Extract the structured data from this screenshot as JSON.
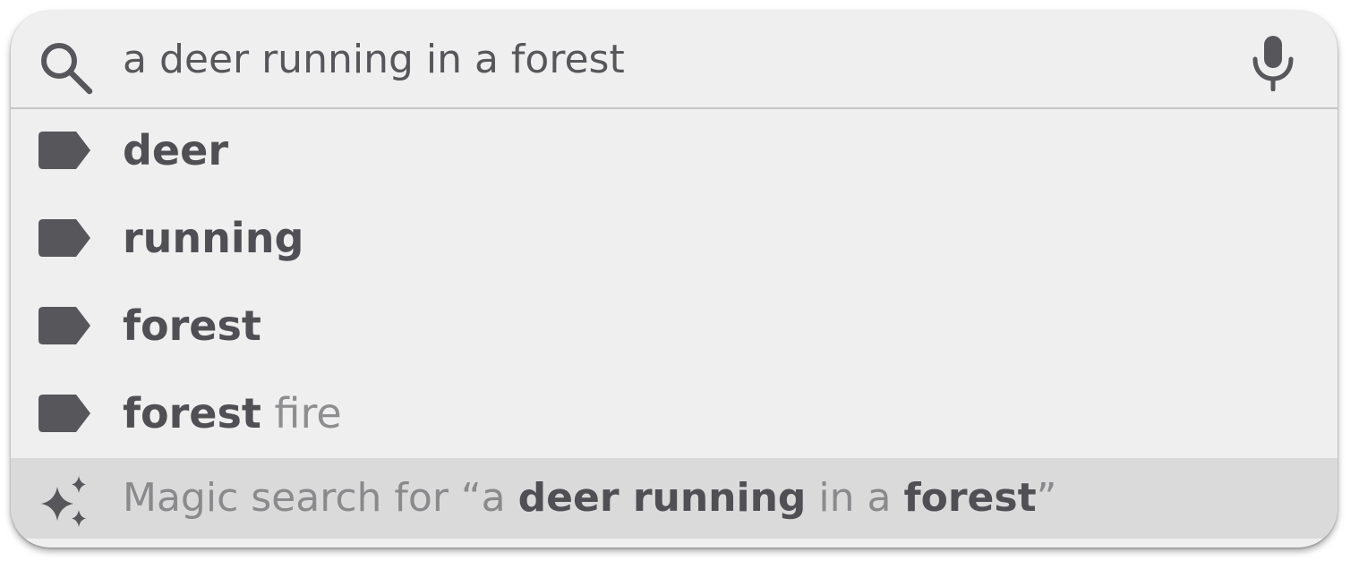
{
  "search": {
    "query": "a deer running in a forest",
    "search_icon": "search-icon",
    "mic_icon": "microphone-icon"
  },
  "suggestions": [
    {
      "icon": "label-icon",
      "bold": "deer",
      "rest": ""
    },
    {
      "icon": "label-icon",
      "bold": "running",
      "rest": ""
    },
    {
      "icon": "label-icon",
      "bold": "forest",
      "rest": ""
    },
    {
      "icon": "label-icon",
      "bold": "forest",
      "rest": " fire"
    }
  ],
  "magic": {
    "icon": "sparkle-icon",
    "prefix": "Magic search for “a ",
    "term1": "deer running",
    "mid": " in a ",
    "term2": "forest",
    "suffix": "”"
  },
  "colors": {
    "panel_background": "#efefef",
    "highlight_row": "#dadada",
    "icon_color": "#57575b",
    "strong_text": "#505054",
    "light_text": "#8e8e91"
  }
}
